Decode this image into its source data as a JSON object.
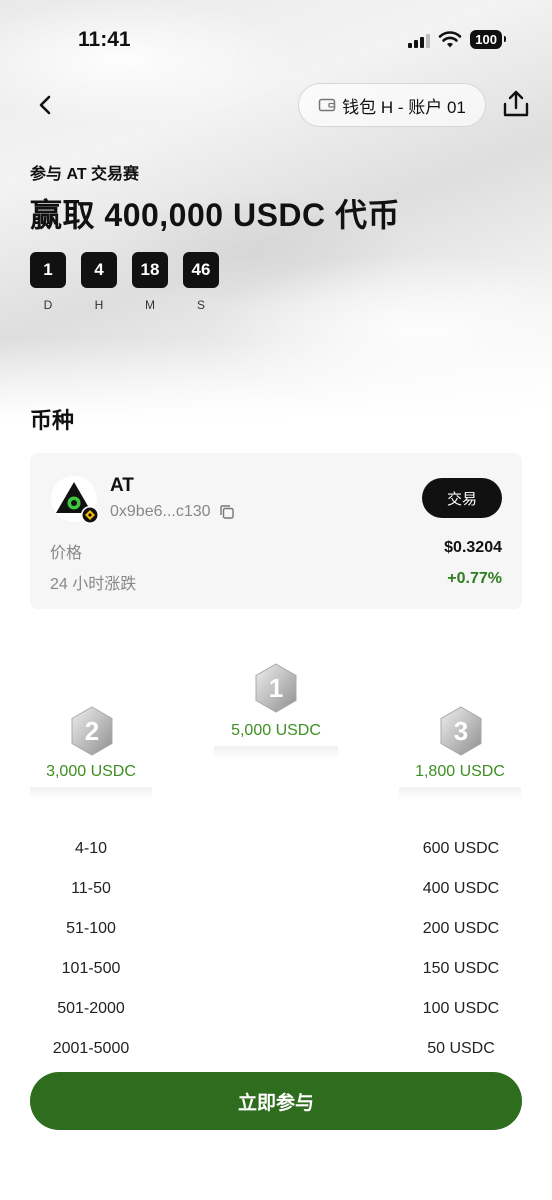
{
  "status_bar": {
    "time": "11:41",
    "battery": "100"
  },
  "header": {
    "wallet_label": "钱包 H - 账户 01"
  },
  "event": {
    "subtitle": "参与 AT 交易赛",
    "title": "赢取 400,000 USDC 代币",
    "countdown": [
      {
        "value": "1",
        "label": "D"
      },
      {
        "value": "4",
        "label": "H"
      },
      {
        "value": "18",
        "label": "M"
      },
      {
        "value": "46",
        "label": "S"
      }
    ]
  },
  "token_section": {
    "title": "币种",
    "token": {
      "name": "AT",
      "address": "0x9be6...c130",
      "trade_label": "交易",
      "price_label": "价格",
      "price_value": "$0.3204",
      "change_label": "24 小时涨跌",
      "change_value": "+0.77%"
    }
  },
  "podium": [
    {
      "rank": "1",
      "prize": "5,000 USDC"
    },
    {
      "rank": "2",
      "prize": "3,000 USDC"
    },
    {
      "rank": "3",
      "prize": "1,800 USDC"
    }
  ],
  "ranks": [
    {
      "range": "4-10",
      "prize": "600 USDC"
    },
    {
      "range": "11-50",
      "prize": "400 USDC"
    },
    {
      "range": "51-100",
      "prize": "200 USDC"
    },
    {
      "range": "101-500",
      "prize": "150 USDC"
    },
    {
      "range": "501-2000",
      "prize": "100 USDC"
    },
    {
      "range": "2001-5000",
      "prize": "50 USDC"
    }
  ],
  "cta": {
    "label": "立即参与"
  },
  "colors": {
    "accent_green": "#2f6d1e",
    "prize_green": "#3e8f21",
    "up_green": "#2e7d1e"
  }
}
